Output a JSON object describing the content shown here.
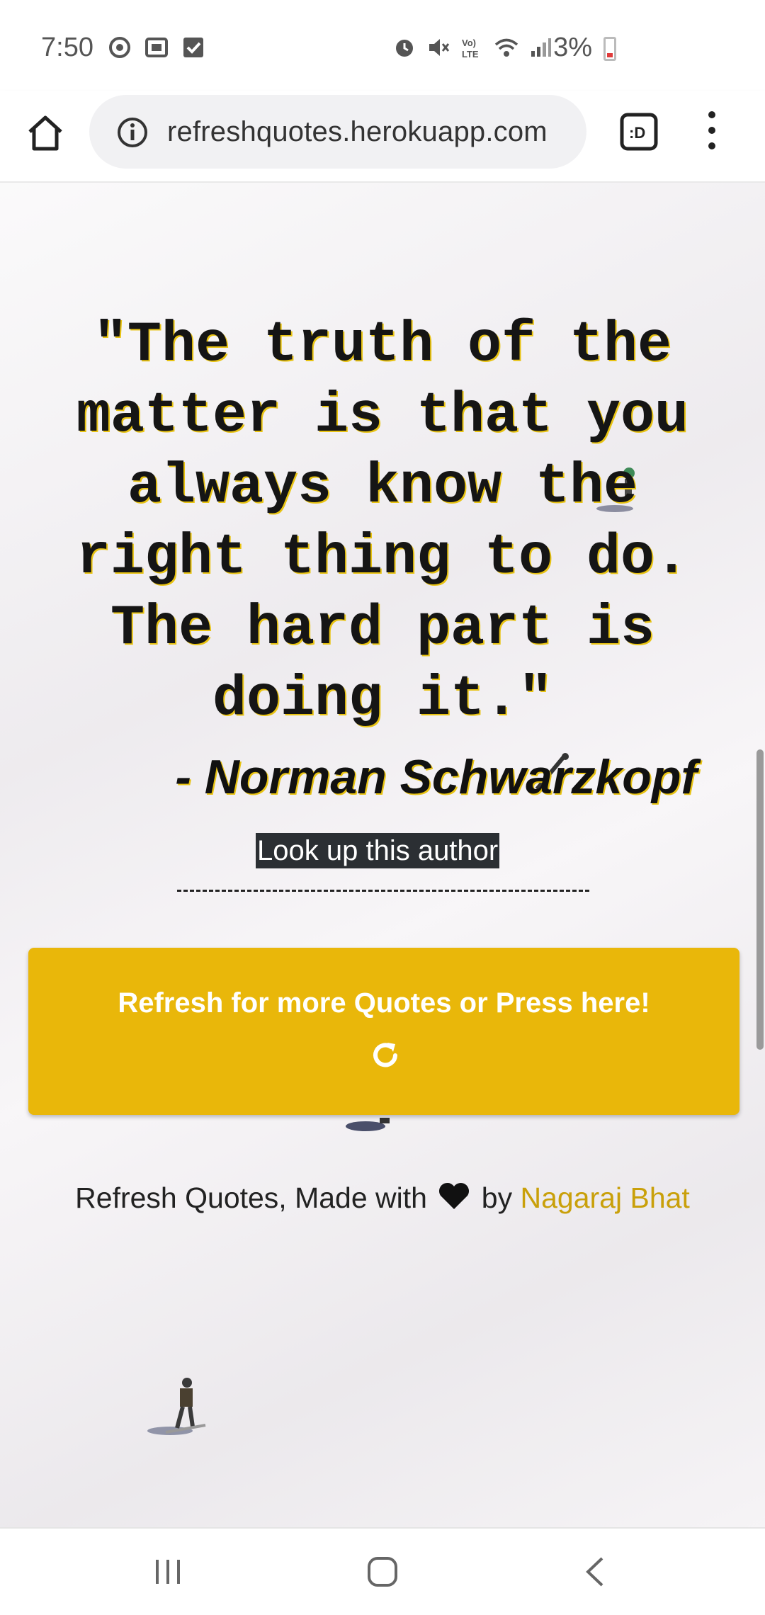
{
  "status_bar": {
    "time": "7:50",
    "battery": "3%",
    "icons": [
      "sync-icon",
      "screenshot-icon",
      "check-icon",
      "alarm-icon",
      "mute-icon",
      "volte-icon",
      "wifi-icon",
      "signal-icon",
      "battery-icon"
    ]
  },
  "browser": {
    "url": "refreshquotes.herokuapp.com"
  },
  "quote": {
    "text": "\"The truth of the matter is that you always know the right thing to do. The hard part is doing it.\"",
    "author": "- Norman Schwarzkopf",
    "lookup_label": "Look up this author",
    "divider": "------------------------------------------------"
  },
  "refresh_button": {
    "label": "Refresh for more Quotes or Press here!"
  },
  "footer": {
    "prefix": "Refresh Quotes, Made with",
    "by": "by",
    "author": "Nagaraj Bhat"
  },
  "colors": {
    "accent": "#e9b70a",
    "link": "#c9a00a",
    "text": "#151515"
  }
}
